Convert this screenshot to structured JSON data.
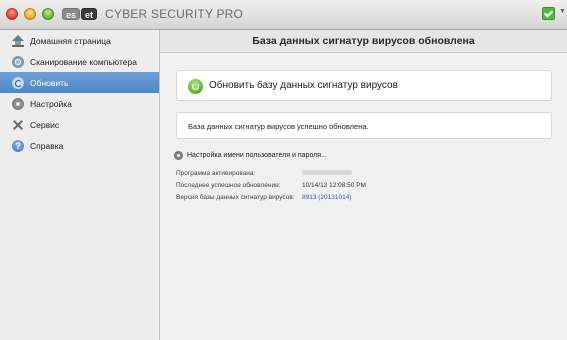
{
  "window": {
    "logo_part1": "es",
    "logo_part2": "et",
    "title": "CYBER SECURITY PRO",
    "status": "protected-checkmark-icon"
  },
  "colors": {
    "accent": "#4f86c6",
    "success": "#56b845",
    "link": "#2e5fb0"
  },
  "sidebar": {
    "items": [
      {
        "label": "Домашняя страница",
        "icon": "home-icon"
      },
      {
        "label": "Сканирование компьютера",
        "icon": "scan-icon"
      },
      {
        "label": "Обновить",
        "icon": "update-icon",
        "active": true
      },
      {
        "label": "Настройка",
        "icon": "gear-icon"
      },
      {
        "label": "Сервис",
        "icon": "tools-icon"
      },
      {
        "label": "Справка",
        "icon": "help-icon"
      }
    ]
  },
  "main": {
    "header": "База данных сигнатур вирусов обновлена",
    "update_button": "Обновить базу данных сигнатур вирусов",
    "message": "База данных сигнатур вирусов успешно обновлена.",
    "settings_link": "Настройка имени пользователя и пароля...",
    "info": [
      {
        "label": "Программа активирована:",
        "value": ""
      },
      {
        "label": "Последнее успешное обновление:",
        "value": "10/14/13 12:08:50 PM"
      },
      {
        "label": "Версия базы данных сигнатур вирусов:",
        "value": "8913 (20131014)"
      }
    ]
  }
}
